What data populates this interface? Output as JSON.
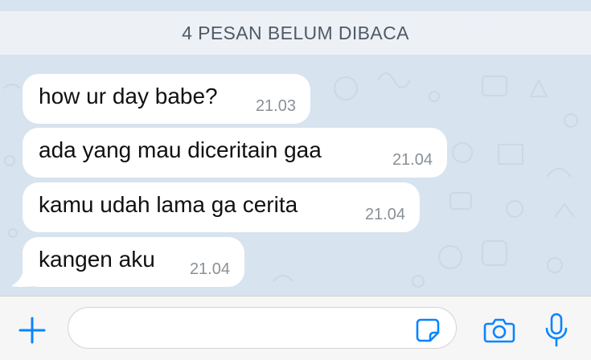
{
  "banner": {
    "text": "4 PESAN BELUM DIBACA"
  },
  "messages": [
    {
      "text": "how ur day babe?",
      "time": "21.03"
    },
    {
      "text": "ada yang mau diceritain gaa",
      "time": "21.04"
    },
    {
      "text": "kamu udah lama ga cerita",
      "time": "21.04"
    },
    {
      "text": "kangen aku",
      "time": "21.04"
    }
  ],
  "composer": {
    "placeholder": "",
    "value": ""
  },
  "icons": {
    "add": "plus-icon",
    "sticker": "sticker-icon",
    "camera": "camera-icon",
    "mic": "microphone-icon"
  },
  "colors": {
    "accent": "#0a84ff",
    "chat_background": "#d7e3ee",
    "bubble": "#ffffff"
  }
}
